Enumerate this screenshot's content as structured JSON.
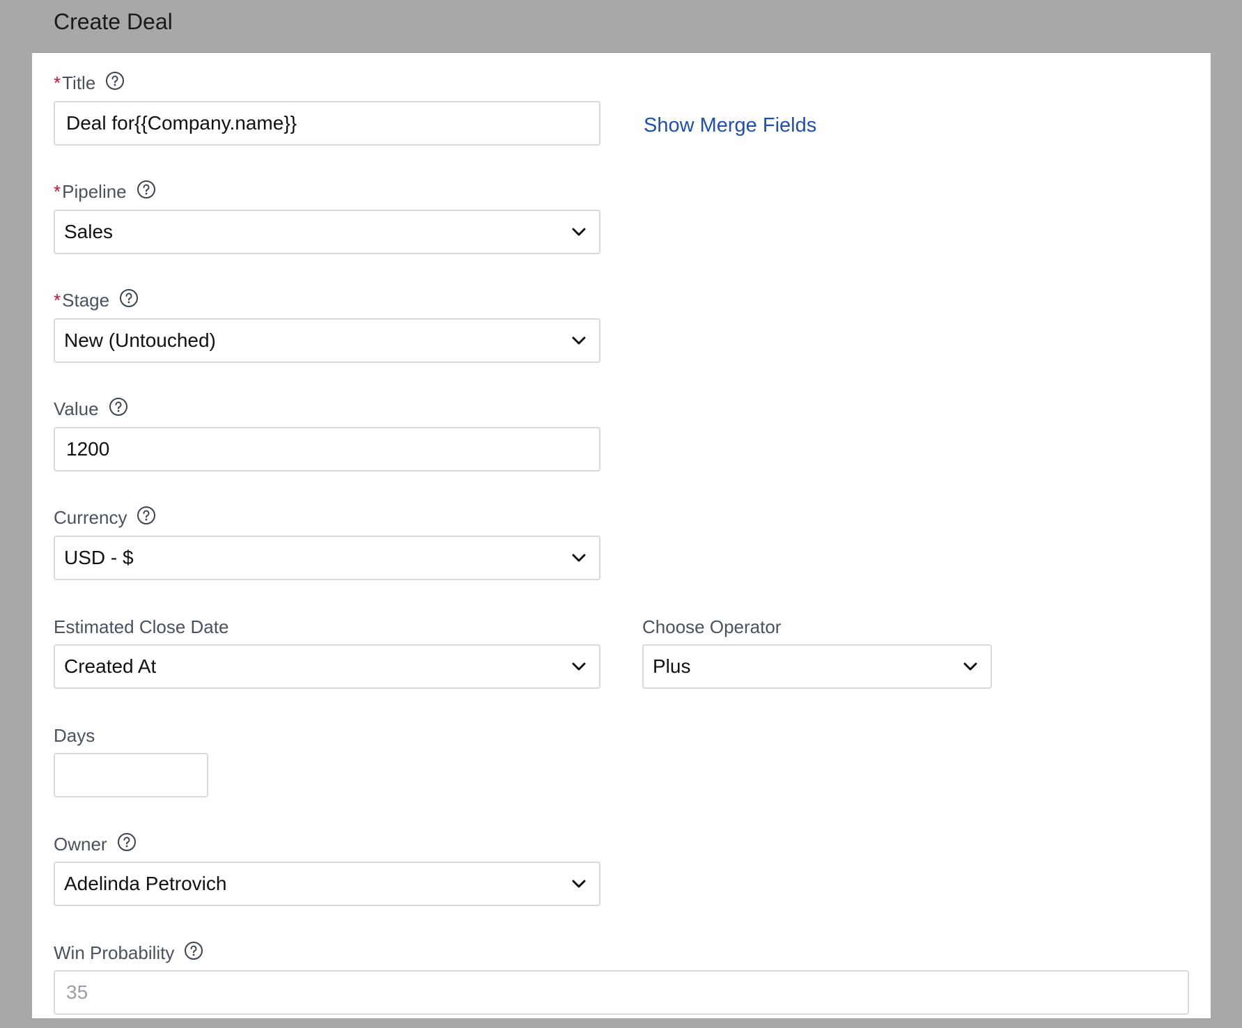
{
  "modal": {
    "title": "Create Deal"
  },
  "fields": {
    "title": {
      "label": "Title",
      "required_mark": "*",
      "value": "Deal for{{Company.name}}"
    },
    "merge_link": "Show Merge Fields",
    "pipeline": {
      "label": "Pipeline",
      "required_mark": "*",
      "value": "Sales"
    },
    "stage": {
      "label": "Stage",
      "required_mark": "*",
      "value": "New (Untouched)"
    },
    "value": {
      "label": "Value",
      "value": "1200"
    },
    "currency": {
      "label": "Currency",
      "value": "USD - $"
    },
    "close_date": {
      "label": "Estimated Close Date",
      "value": "Created At"
    },
    "operator": {
      "label": "Choose Operator",
      "value": "Plus"
    },
    "days": {
      "label": "Days",
      "value": ""
    },
    "owner": {
      "label": "Owner",
      "value": "Adelinda Petrovich"
    },
    "win_probability": {
      "label": "Win Probability",
      "value": "35"
    }
  },
  "icons": {
    "help": "question-circle-icon",
    "dropdown": "chevron-down-icon"
  },
  "colors": {
    "required": "#c8102e",
    "link": "#1f4fb4",
    "overlay": "#a8a8a8"
  }
}
